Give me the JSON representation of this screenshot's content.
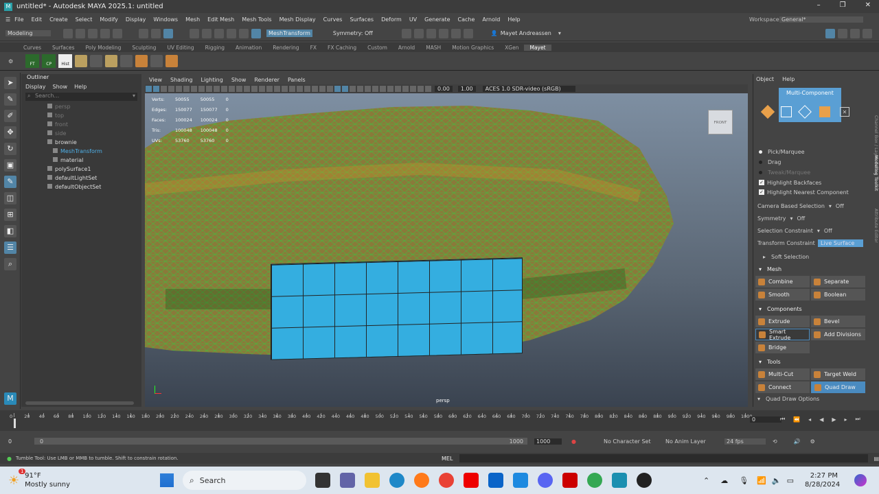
{
  "window": {
    "title": "untitled* - Autodesk MAYA 2025.1: untitled",
    "controls": [
      "minimize",
      "maximize",
      "close"
    ]
  },
  "menus": [
    "File",
    "Edit",
    "Create",
    "Select",
    "Modify",
    "Display",
    "Windows",
    "Mesh",
    "Edit Mesh",
    "Mesh Tools",
    "Mesh Display",
    "Curves",
    "Surfaces",
    "Deform",
    "UV",
    "Generate",
    "Cache",
    "Arnold",
    "Help"
  ],
  "workspace": {
    "label": "Workspace:",
    "value": "General*"
  },
  "statusline": {
    "mode": "Modeling",
    "mesh_transform": "MeshTransform",
    "symmetry": "Symmetry: Off",
    "user": "Mayet Andreassen"
  },
  "shelf_tabs": [
    "Curves",
    "Surfaces",
    "Poly Modeling",
    "Sculpting",
    "UV Editing",
    "Rigging",
    "Animation",
    "Rendering",
    "FX",
    "FX Caching",
    "Custom",
    "Arnold",
    "MASH",
    "Motion Graphics",
    "XGen",
    "Mayet"
  ],
  "shelf_buttons": [
    "FT",
    "CP",
    "Hist"
  ],
  "outliner": {
    "title": "Outliner",
    "menu": [
      "Display",
      "Show",
      "Help"
    ],
    "search_placeholder": "Search...",
    "items": [
      "persp",
      "top",
      "front",
      "side",
      "brownie",
      "MeshTransform",
      "material",
      "polySurface1",
      "defaultLightSet",
      "defaultObjectSet"
    ]
  },
  "viewport": {
    "menu": [
      "View",
      "Shading",
      "Lighting",
      "Show",
      "Renderer",
      "Panels"
    ],
    "field1": "0.00",
    "field2": "1.00",
    "colorspace": "ACES 1.0 SDR-video (sRGB)",
    "camera": "persp",
    "viewcube": "FRONT",
    "hud": [
      [
        "Verts:",
        "50055",
        "50055",
        "0"
      ],
      [
        "Edges:",
        "150077",
        "150077",
        "0"
      ],
      [
        "Faces:",
        "100024",
        "100024",
        "0"
      ],
      [
        "Tris:",
        "100048",
        "100048",
        "0"
      ],
      [
        "UVs:",
        "53760",
        "53760",
        "0"
      ]
    ]
  },
  "modeling_toolkit": {
    "menu": [
      "Object",
      "Help"
    ],
    "mode": "Multi-Component",
    "options": [
      "Pick/Marquee",
      "Drag",
      "Tweak/Marquee"
    ],
    "checks": [
      "Highlight Backfaces",
      "Highlight Nearest Component"
    ],
    "camera_based": {
      "label": "Camera Based Selection",
      "value": "Off"
    },
    "symmetry": {
      "label": "Symmetry",
      "value": "Off"
    },
    "selection_constraint": {
      "label": "Selection Constraint",
      "value": "Off"
    },
    "transform_constraint": {
      "label": "Transform Constraint",
      "value": "Live Surface"
    },
    "soft_selection": "Soft Selection",
    "sections": [
      {
        "title": "Mesh",
        "buttons": [
          "Combine",
          "Separate",
          "Smooth",
          "Boolean"
        ]
      },
      {
        "title": "Components",
        "buttons": [
          "Extrude",
          "Bevel",
          "Smart Extrude",
          "Add Divisions",
          "Bridge"
        ]
      },
      {
        "title": "Tools",
        "buttons": [
          "Multi-Cut",
          "Target Weld",
          "Connect",
          "Quad Draw"
        ]
      }
    ],
    "more": "Quad Draw Options",
    "side_tabs": [
      "Channel Box / Layer Editor",
      "Modeling Toolkit",
      "Attribute Editor"
    ]
  },
  "timeline": {
    "ticks": [
      "0",
      "20",
      "40",
      "60",
      "80",
      "100",
      "120",
      "140",
      "160",
      "180",
      "200",
      "220",
      "240",
      "260",
      "280",
      "300",
      "320",
      "340",
      "360",
      "380",
      "400",
      "420",
      "440",
      "460",
      "480",
      "500",
      "520",
      "540",
      "560",
      "580",
      "600",
      "620",
      "640",
      "660",
      "680",
      "700",
      "720",
      "740",
      "760",
      "780",
      "800",
      "820",
      "840",
      "860",
      "880",
      "900",
      "920",
      "940",
      "960",
      "980",
      "1000"
    ],
    "current_frame": "0"
  },
  "range": {
    "start": "0",
    "inner_start": "0",
    "inner_end": "1000",
    "end": "1000",
    "character_set": "No Character Set",
    "anim_layer": "No Anim Layer",
    "fps": "24 fps"
  },
  "cmdline": {
    "help": "Tumble Tool: Use LMB or MMB to tumble. Shift to constrain rotation.",
    "lang": "MEL"
  },
  "taskbar": {
    "weather_temp": "91°F",
    "weather_desc": "Mostly sunny",
    "weather_badge": "1",
    "search": "Search",
    "time": "2:27 PM",
    "date": "8/28/2024"
  }
}
